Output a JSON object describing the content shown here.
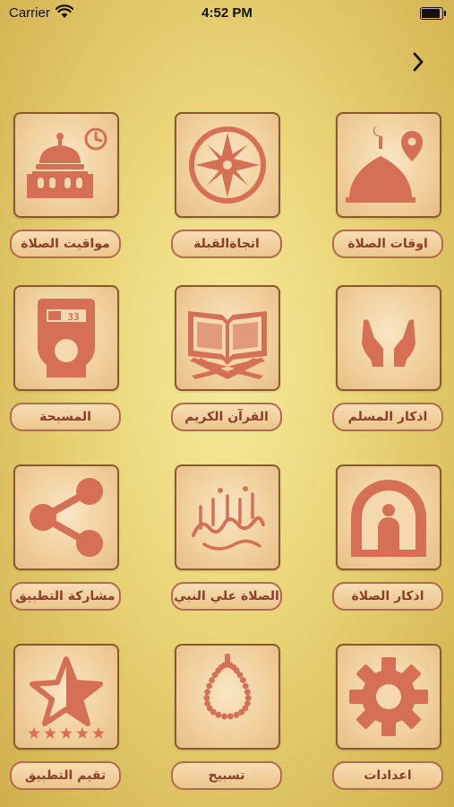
{
  "status_bar": {
    "carrier": "Carrier",
    "time": "4:52 PM",
    "battery_level": 1.0
  },
  "colors": {
    "icon": "#d57056",
    "label_text": "#8a3f2a",
    "border": "#8a5a2e"
  },
  "tiles": [
    {
      "label": "مواقيت الصلاة",
      "icon": "mosque-clock-icon"
    },
    {
      "label": "اتجاةالقبلة",
      "icon": "compass-icon"
    },
    {
      "label": "اوقات الصلاة",
      "icon": "mosque-location-icon"
    },
    {
      "label": "المسبحة",
      "icon": "tally-counter-icon",
      "counter_value": "33"
    },
    {
      "label": "القرآن الكريم",
      "icon": "quran-icon"
    },
    {
      "label": "اذكار المسلم",
      "icon": "praying-hands-icon"
    },
    {
      "label": "مشاركة التطبيق",
      "icon": "share-icon"
    },
    {
      "label": "الصلاة علي النبي",
      "icon": "calligraphy-icon"
    },
    {
      "label": "اذكار الصلاة",
      "icon": "praying-man-icon"
    },
    {
      "label": "تقيم التطبيق",
      "icon": "star-rating-icon",
      "rating": 5
    },
    {
      "label": "تسبيح",
      "icon": "prayer-beads-icon"
    },
    {
      "label": "اعدادات",
      "icon": "gear-icon"
    }
  ]
}
